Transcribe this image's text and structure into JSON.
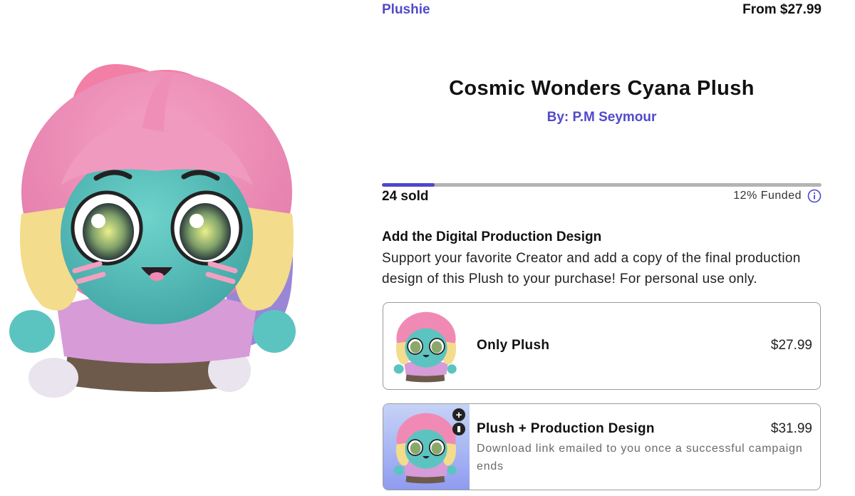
{
  "header": {
    "category": "Plushie",
    "price_from": "From $27.99"
  },
  "product": {
    "title": "Cosmic Wonders Cyana Plush",
    "creator": "By: P.M Seymour"
  },
  "funding": {
    "sold": "24 sold",
    "funded_label": "12% Funded",
    "progress_fraction": 0.12,
    "accent": "#4c47cf"
  },
  "addon": {
    "heading": "Add the Digital Production Design",
    "description": "Support your favorite Creator and add a copy of the final production design of this Plush to your purchase! For personal use only."
  },
  "options": [
    {
      "title": "Only Plush",
      "price": "$27.99"
    },
    {
      "title": "Plush + Production Design",
      "price": "$31.99",
      "subtitle": "Download link emailed to you once a successful campaign ends"
    }
  ],
  "icons": {
    "info": "info-circle-icon",
    "plus": "plus-badge-icon",
    "doc": "info-badge-icon"
  },
  "colors": {
    "brand": "#5149cc",
    "track": "#b4b4b4",
    "skin": "#5cc4c0",
    "hair": "#f08ab4",
    "shirt": "#d79bd8"
  }
}
